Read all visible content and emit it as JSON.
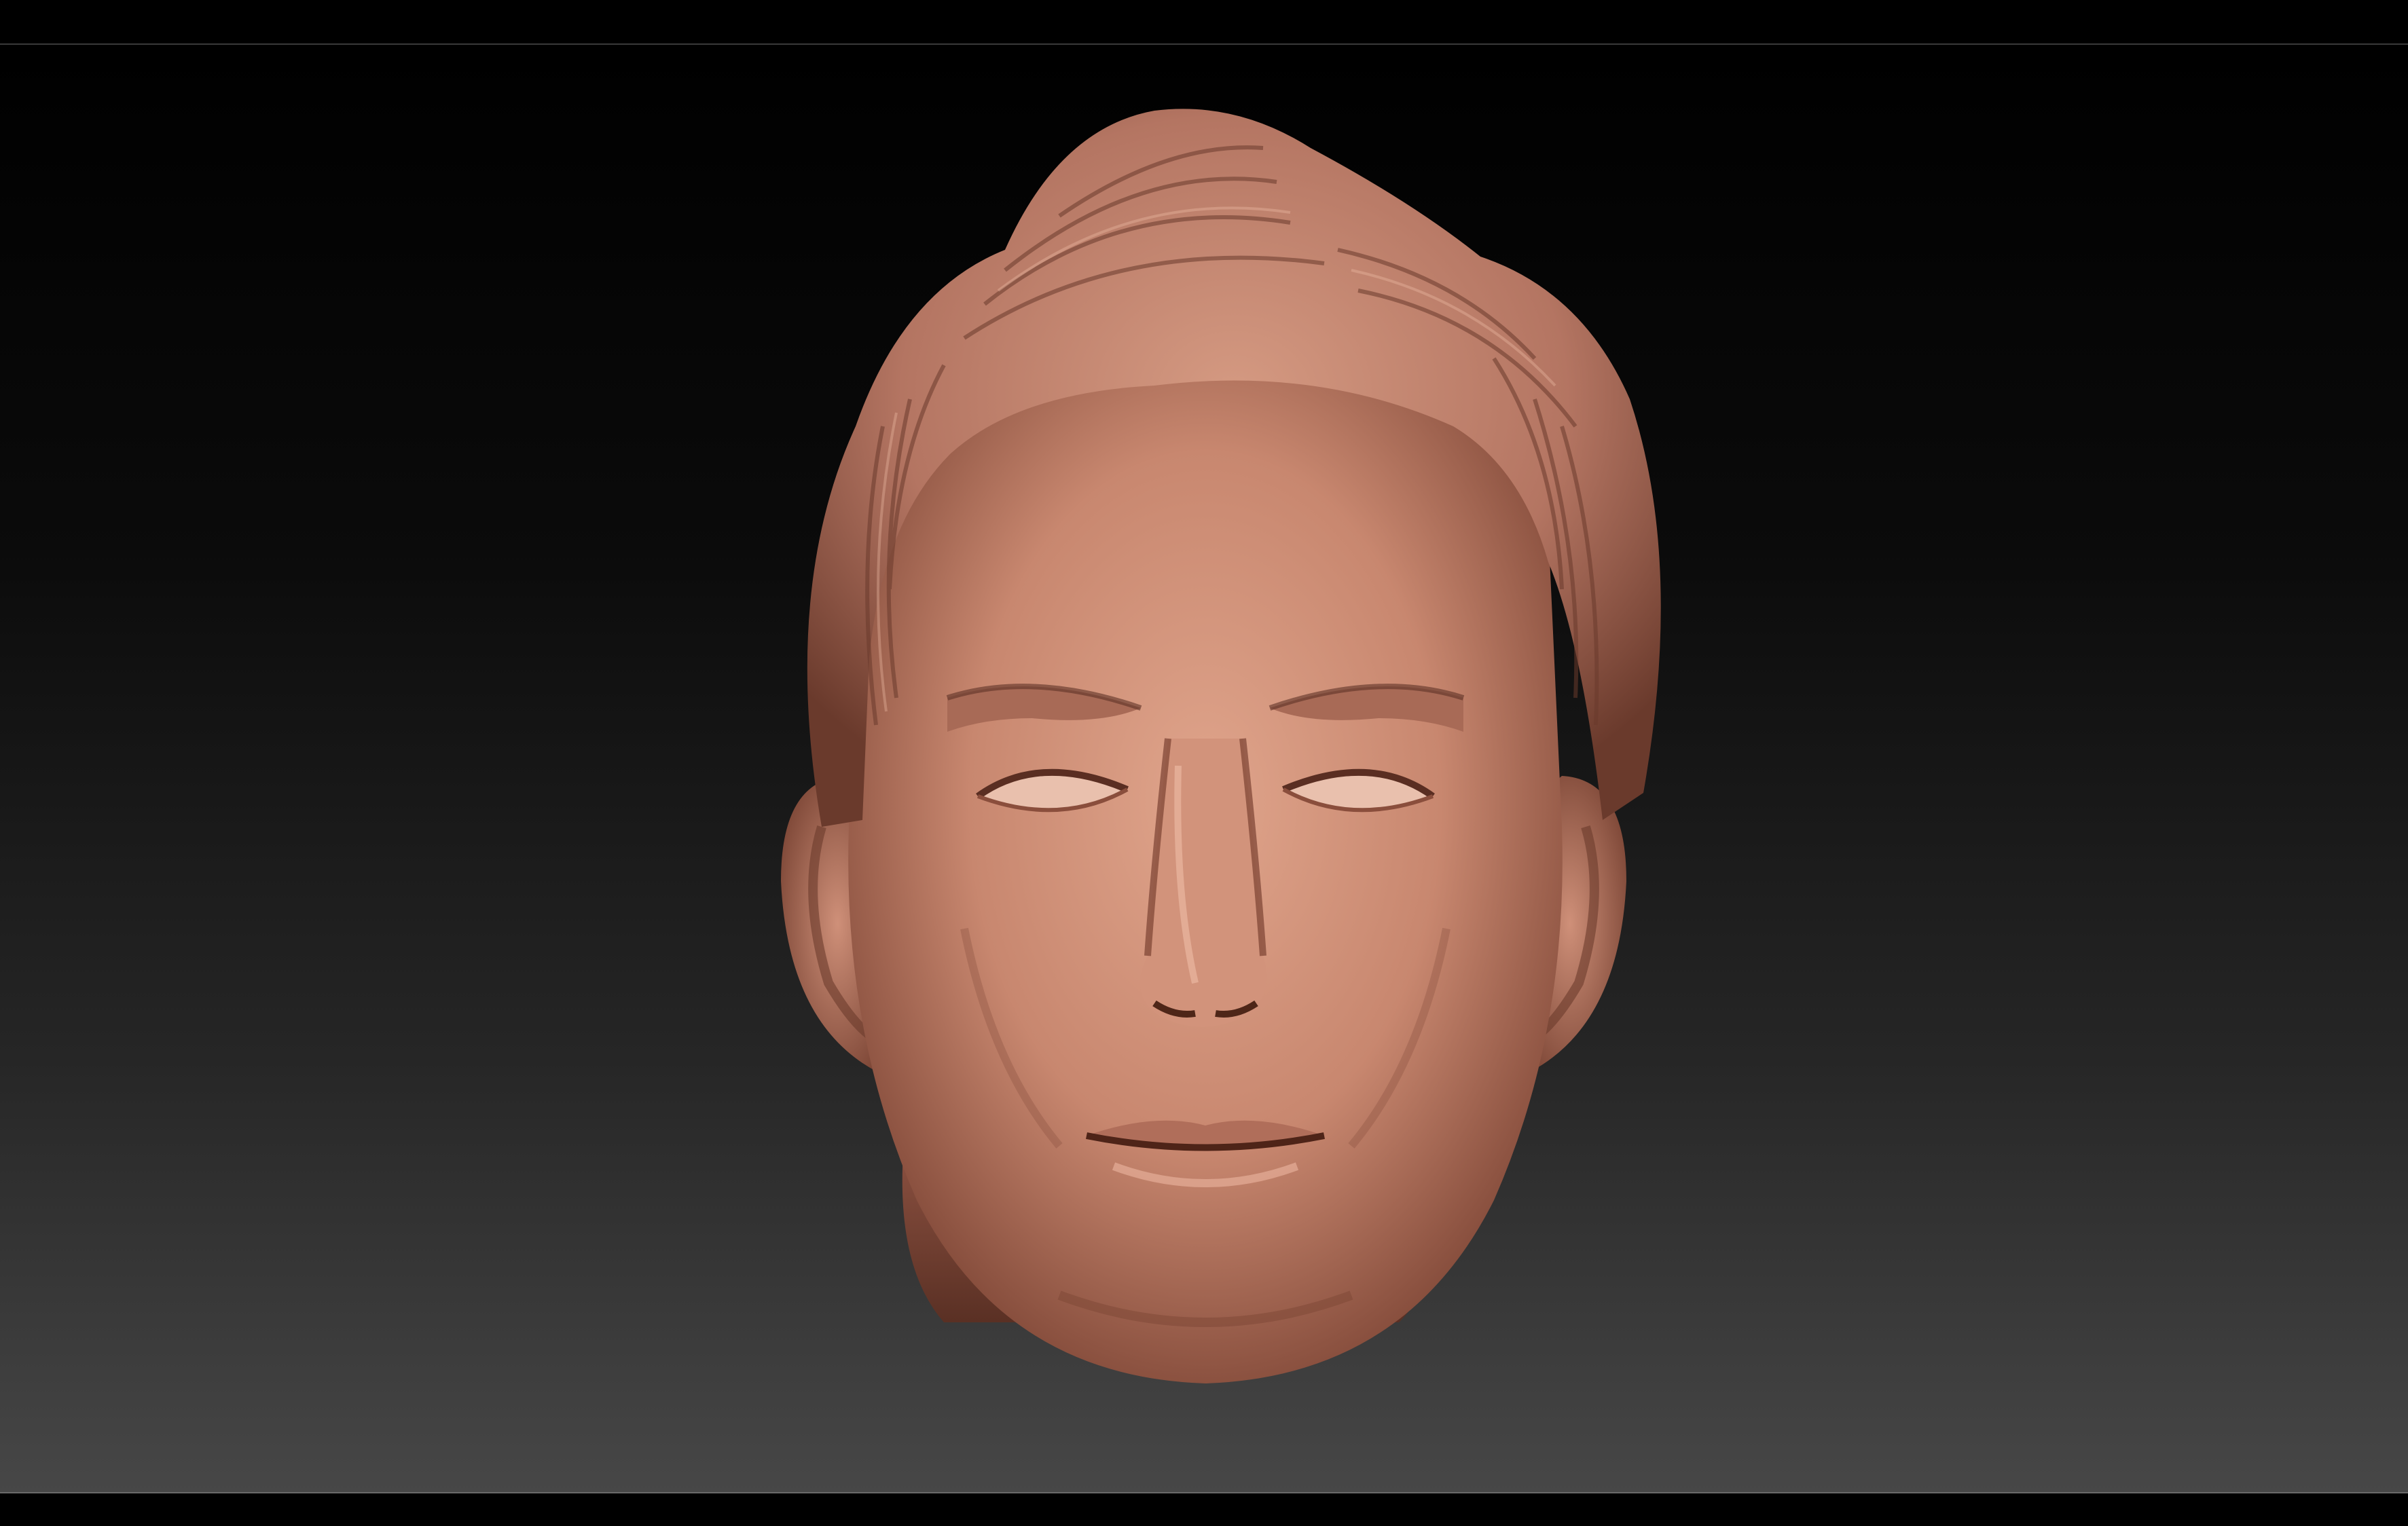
{
  "app": {
    "colors": {
      "background_top": "#000000",
      "background_bottom": "#474747",
      "clay": "#c8876f",
      "clay_shadow": "#6e3b2c",
      "clay_highlight": "#e8b09a",
      "divider": "#6a6a6a"
    }
  },
  "viewport": {
    "object": "sculpted-head-model",
    "material": "clay"
  }
}
